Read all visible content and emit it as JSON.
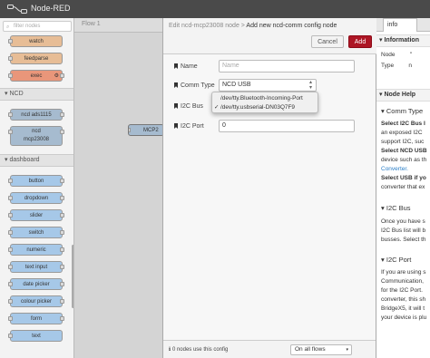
{
  "app": {
    "title": "Node-RED"
  },
  "palette": {
    "filter_placeholder": "filter nodes",
    "nodes_top": [
      "watch",
      "feedparse",
      "exec"
    ],
    "categories": {
      "ncd": "NCD",
      "dashboard": "dashboard"
    },
    "ncd_nodes": [
      "ncd ads1115",
      "ncd\nmcp23008"
    ],
    "dashboard_nodes": [
      "button",
      "dropdown",
      "slider",
      "switch",
      "numeric",
      "text input",
      "date picker",
      "colour picker",
      "form",
      "text"
    ]
  },
  "workspace": {
    "tab": "Flow 1",
    "node_label": "MCP2"
  },
  "tray": {
    "breadcrumb_prefix": "Edit ncd-mcp23008 node > ",
    "breadcrumb_title": "Add new ncd-comm config node",
    "cancel_label": "Cancel",
    "add_label": "Add",
    "fields": {
      "name_label": "Name",
      "name_placeholder": "Name",
      "comm_label": "Comm Type",
      "comm_value": "NCD USB",
      "i2c_bus_label": "I2C Bus",
      "i2c_port_label": "I2C Port",
      "i2c_port_value": "0"
    },
    "dropdown_options": [
      {
        "label": "/dev/tty.Bluetooth-Incoming-Port",
        "checked": false
      },
      {
        "label": "/dev/tty.usbserial-DN03Q7F9",
        "checked": true
      }
    ],
    "footer_text": "0 nodes use this config",
    "flows_select": "On all flows"
  },
  "sidebar": {
    "tab": "info",
    "info_heading": "Information",
    "info_rows": [
      {
        "key": "Node",
        "value": "\""
      },
      {
        "key": "Type",
        "value": "n"
      }
    ],
    "help_heading": "Node Help",
    "comm_type_heading": "Comm Type",
    "help_lines": [
      "Select I2C Bus I",
      "an exposed I2C",
      "support I2C, suc",
      "Select NCD USB",
      "device such as th",
      "Converter.",
      "Select USB if yo",
      "converter that ex"
    ],
    "i2c_bus_heading": "I2C Bus",
    "i2c_bus_lines": [
      "Once you have s",
      "I2C Bus list will b",
      "busses. Select th"
    ],
    "i2c_port_heading": "I2C Port",
    "i2c_port_lines": [
      "If you are using s",
      "Communication,",
      "for the I2C Port.",
      "converter, this sh",
      "BridgeX5, it will t",
      "your device is plu"
    ]
  }
}
